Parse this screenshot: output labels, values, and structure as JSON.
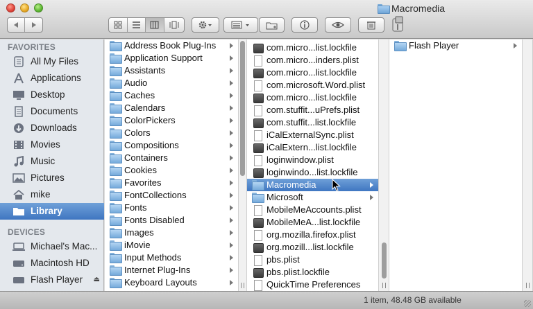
{
  "window": {
    "title": "Macromedia"
  },
  "toolbar": {
    "nav": [
      "back",
      "forward"
    ],
    "view_modes": [
      "icon-view",
      "list-view",
      "column-view",
      "coverflow-view"
    ],
    "active_view": "column-view"
  },
  "sidebar": {
    "favorites_heading": "FAVORITES",
    "devices_heading": "DEVICES",
    "favorites": [
      {
        "label": "All My Files",
        "icon": "all-files-icon"
      },
      {
        "label": "Applications",
        "icon": "applications-icon"
      },
      {
        "label": "Desktop",
        "icon": "desktop-icon"
      },
      {
        "label": "Documents",
        "icon": "documents-icon"
      },
      {
        "label": "Downloads",
        "icon": "downloads-icon"
      },
      {
        "label": "Movies",
        "icon": "movies-icon"
      },
      {
        "label": "Music",
        "icon": "music-icon"
      },
      {
        "label": "Pictures",
        "icon": "pictures-icon"
      },
      {
        "label": "mike",
        "icon": "home-icon"
      },
      {
        "label": "Library",
        "icon": "folder-icon",
        "selected": true
      }
    ],
    "devices": [
      {
        "label": "Michael's Mac...",
        "icon": "computer-icon"
      },
      {
        "label": "Macintosh HD",
        "icon": "hard-drive-icon"
      },
      {
        "label": "Flash Player",
        "icon": "disk-image-icon",
        "ejectable": true
      }
    ]
  },
  "column1": {
    "items": [
      "Address Book Plug-Ins",
      "Application Support",
      "Assistants",
      "Audio",
      "Caches",
      "Calendars",
      "ColorPickers",
      "Colors",
      "Compositions",
      "Containers",
      "Cookies",
      "Favorites",
      "FontCollections",
      "Fonts",
      "Fonts Disabled",
      "Images",
      "iMovie",
      "Input Methods",
      "Internet Plug-Ins",
      "Keyboard Layouts"
    ]
  },
  "column2": {
    "items": [
      {
        "label": "com.micro...list.lockfile",
        "kind": "lockfile"
      },
      {
        "label": "com.micro...inders.plist",
        "kind": "plist"
      },
      {
        "label": "com.micro...list.lockfile",
        "kind": "lockfile"
      },
      {
        "label": "com.microsoft.Word.plist",
        "kind": "plist"
      },
      {
        "label": "com.micro...list.lockfile",
        "kind": "lockfile"
      },
      {
        "label": "com.stuffit...uPrefs.plist",
        "kind": "plist"
      },
      {
        "label": "com.stuffit...list.lockfile",
        "kind": "lockfile"
      },
      {
        "label": "iCalExternalSync.plist",
        "kind": "plist"
      },
      {
        "label": "iCalExtern...list.lockfile",
        "kind": "lockfile"
      },
      {
        "label": "loginwindow.plist",
        "kind": "plist"
      },
      {
        "label": "loginwindo...list.lockfile",
        "kind": "lockfile"
      },
      {
        "label": "Macromedia",
        "kind": "folder",
        "selected": true
      },
      {
        "label": "Microsoft",
        "kind": "folder"
      },
      {
        "label": "MobileMeAccounts.plist",
        "kind": "plist"
      },
      {
        "label": "MobileMeA...list.lockfile",
        "kind": "lockfile"
      },
      {
        "label": "org.mozilla.firefox.plist",
        "kind": "plist"
      },
      {
        "label": "org.mozill...list.lockfile",
        "kind": "lockfile"
      },
      {
        "label": "pbs.plist",
        "kind": "plist"
      },
      {
        "label": "pbs.plist.lockfile",
        "kind": "lockfile"
      },
      {
        "label": "QuickTime Preferences",
        "kind": "plist"
      }
    ]
  },
  "column3": {
    "items": [
      {
        "label": "Flash Player",
        "kind": "folder"
      }
    ]
  },
  "status": {
    "text": "1 item, 48.48 GB available"
  }
}
